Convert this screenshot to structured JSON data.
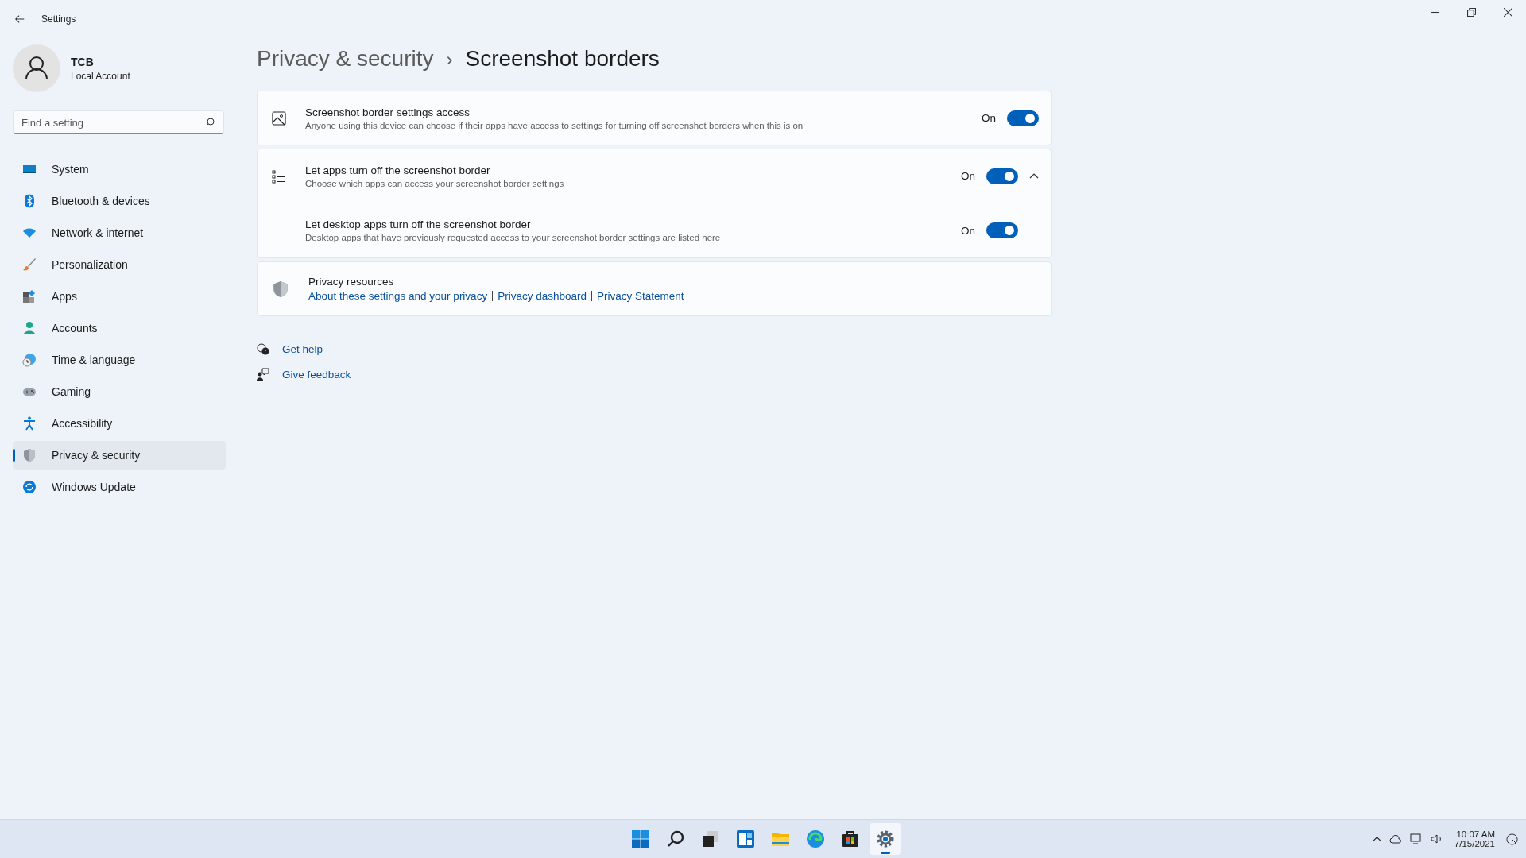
{
  "window": {
    "title": "Settings"
  },
  "account": {
    "name": "TCB",
    "type": "Local Account"
  },
  "search": {
    "placeholder": "Find a setting"
  },
  "sidebar": {
    "items": [
      {
        "label": "System",
        "selected": false
      },
      {
        "label": "Bluetooth & devices",
        "selected": false
      },
      {
        "label": "Network & internet",
        "selected": false
      },
      {
        "label": "Personalization",
        "selected": false
      },
      {
        "label": "Apps",
        "selected": false
      },
      {
        "label": "Accounts",
        "selected": false
      },
      {
        "label": "Time & language",
        "selected": false
      },
      {
        "label": "Gaming",
        "selected": false
      },
      {
        "label": "Accessibility",
        "selected": false
      },
      {
        "label": "Privacy & security",
        "selected": true
      },
      {
        "label": "Windows Update",
        "selected": false
      }
    ]
  },
  "breadcrumb": {
    "parent": "Privacy & security",
    "separator": "›",
    "current": "Screenshot borders"
  },
  "settings": [
    {
      "title": "Screenshot border settings access",
      "description": "Anyone using this device can choose if their apps have access to settings for turning off screenshot borders when this is on",
      "state_label": "On",
      "on": true
    },
    {
      "title": "Let apps turn off the screenshot border",
      "description": "Choose which apps can access your screenshot border settings",
      "state_label": "On",
      "on": true,
      "expanded": true,
      "children": [
        {
          "title": "Let desktop apps turn off the screenshot border",
          "description": "Desktop apps that have previously requested access to your screenshot border settings are listed here",
          "state_label": "On",
          "on": true
        }
      ]
    }
  ],
  "privacy_resources": {
    "title": "Privacy resources",
    "links": [
      "About these settings and your privacy",
      "Privacy dashboard",
      "Privacy Statement"
    ]
  },
  "help_links": [
    "Get help",
    "Give feedback"
  ],
  "taskbar": {
    "apps": [
      {
        "selected": false
      },
      {
        "selected": false
      },
      {
        "selected": false
      },
      {
        "selected": false
      },
      {
        "selected": false
      },
      {
        "selected": false
      },
      {
        "selected": false
      },
      {
        "selected": true
      }
    ],
    "time": "10:07 AM",
    "date": "7/15/2021"
  }
}
